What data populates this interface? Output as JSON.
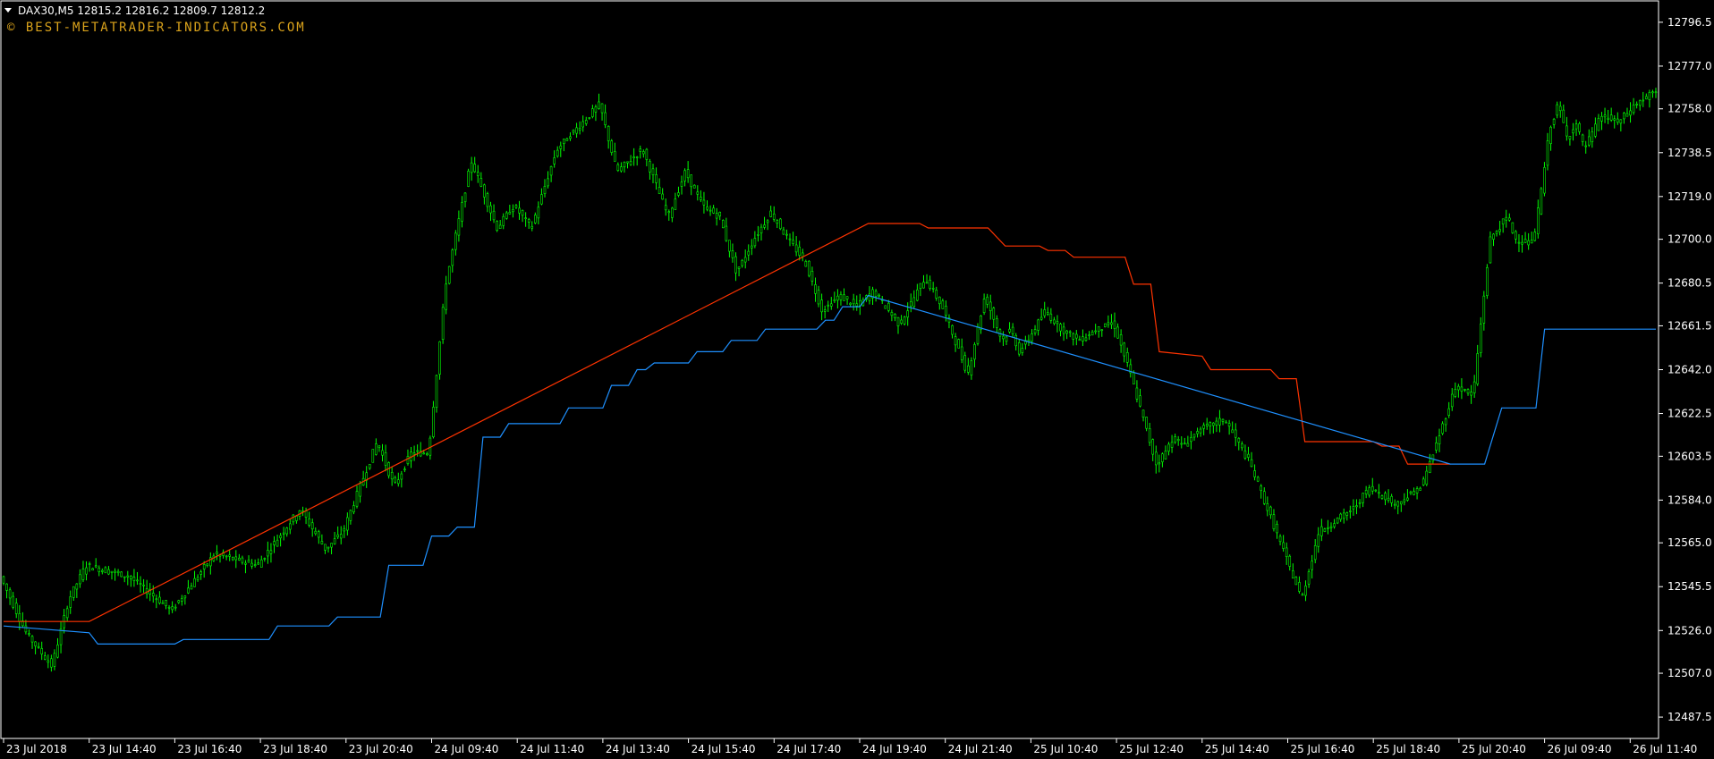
{
  "header": {
    "symbol_info": "DAX30,M5  12815.2 12816.2 12809.7 12812.2",
    "watermark": "© BEST-METATRADER-INDICATORS.COM"
  },
  "colors": {
    "background": "#000000",
    "frame": "#ffffff",
    "candle": "#00ff00",
    "stop_upper": "#ff3300",
    "stop_lower": "#1e90ff",
    "text": "#ffffff",
    "watermark": "#d9a21b"
  },
  "chart_data": {
    "type": "line",
    "title": "",
    "xlabel": "",
    "ylabel": "",
    "ylim": [
      12478,
      12806
    ],
    "y_ticks": [
      "12796.5",
      "12777.0",
      "12758.0",
      "12738.5",
      "12719.0",
      "12700.0",
      "12680.5",
      "12661.5",
      "12642.0",
      "12622.5",
      "12603.5",
      "12584.0",
      "12565.0",
      "12545.5",
      "12526.0",
      "12507.0",
      "12487.5"
    ],
    "x_ticks": [
      "23 Jul 2018",
      "23 Jul 14:40",
      "23 Jul 16:40",
      "23 Jul 18:40",
      "23 Jul 20:40",
      "24 Jul 09:40",
      "24 Jul 11:40",
      "24 Jul 13:40",
      "24 Jul 15:40",
      "24 Jul 17:40",
      "24 Jul 19:40",
      "24 Jul 21:40",
      "25 Jul 10:40",
      "25 Jul 12:40",
      "25 Jul 14:40",
      "25 Jul 16:40",
      "25 Jul 18:40",
      "25 Jul 20:40",
      "26 Jul 09:40",
      "26 Jul 11:40"
    ],
    "x_tick_positions": [
      0,
      10,
      20,
      30,
      40,
      50,
      60,
      70,
      80,
      90,
      100,
      110,
      120,
      130,
      140,
      150,
      160,
      170,
      180,
      190
    ],
    "x_range": [
      0,
      193
    ],
    "series": [
      {
        "name": "",
        "role": "price",
        "x": [
          0,
          3,
          6,
          8,
          10,
          15,
          20,
          25,
          30,
          35,
          38,
          40,
          44,
          46,
          48,
          50,
          52,
          55,
          58,
          60,
          62,
          65,
          70,
          72,
          75,
          78,
          80,
          82,
          84,
          86,
          88,
          90,
          92,
          94,
          96,
          98,
          100,
          102,
          105,
          108,
          110,
          113,
          115,
          117,
          118,
          119,
          120,
          122,
          124,
          126,
          128,
          130,
          132,
          135,
          136,
          137,
          138,
          140,
          143,
          146,
          150,
          152,
          154,
          156,
          158,
          160,
          163,
          166,
          168,
          170,
          172,
          174,
          176,
          177,
          179,
          180,
          181,
          182,
          183,
          184,
          185,
          187,
          189,
          191,
          193
        ],
        "y": [
          12550,
          12525,
          12510,
          12540,
          12555,
          12550,
          12535,
          12560,
          12555,
          12580,
          12562,
          12570,
          12610,
          12590,
          12605,
          12605,
          12680,
          12735,
          12705,
          12715,
          12705,
          12740,
          12760,
          12730,
          12740,
          12710,
          12730,
          12715,
          12710,
          12685,
          12700,
          12712,
          12700,
          12690,
          12668,
          12675,
          12670,
          12677,
          12662,
          12683,
          12670,
          12640,
          12675,
          12655,
          12660,
          12650,
          12655,
          12668,
          12660,
          12655,
          12660,
          12663,
          12640,
          12600,
          12605,
          12612,
          12608,
          12615,
          12620,
          12600,
          12560,
          12540,
          12570,
          12575,
          12580,
          12590,
          12582,
          12590,
          12612,
          12635,
          12630,
          12700,
          12710,
          12700,
          12698,
          12722,
          12750,
          12760,
          12745,
          12752,
          12740,
          12755,
          12752,
          12760,
          12765
        ]
      },
      {
        "name": "",
        "role": "stop-upper",
        "x": [
          0,
          10,
          101,
          107,
          108,
          115,
          117,
          121,
          122,
          124,
          125,
          131,
          132,
          134,
          135,
          140,
          141,
          148,
          149,
          151,
          152,
          160,
          161,
          163,
          164,
          169
        ],
        "y": [
          12530,
          12530,
          12707,
          12707,
          12705,
          12705,
          12697,
          12697,
          12695,
          12695,
          12692,
          12692,
          12680,
          12680,
          12650,
          12648,
          12642,
          12642,
          12638,
          12638,
          12610,
          12610,
          12608,
          12608,
          12600,
          12600
        ]
      },
      {
        "name": "",
        "role": "stop-lower",
        "x": [
          0,
          10,
          11,
          20,
          21,
          31,
          32,
          38,
          39,
          44,
          45,
          49,
          50,
          52,
          53,
          55,
          56,
          58,
          59,
          65,
          66,
          70,
          71,
          73,
          74,
          75,
          76,
          80,
          81,
          84,
          85,
          88,
          89,
          95,
          96,
          97,
          98,
          100,
          101,
          169,
          170,
          172,
          173,
          175,
          176,
          179,
          180,
          190,
          193
        ],
        "y": [
          12528,
          12525,
          12520,
          12520,
          12522,
          12522,
          12528,
          12528,
          12532,
          12532,
          12555,
          12555,
          12568,
          12568,
          12572,
          12572,
          12612,
          12612,
          12618,
          12618,
          12625,
          12625,
          12635,
          12635,
          12642,
          12642,
          12645,
          12645,
          12650,
          12650,
          12655,
          12655,
          12660,
          12660,
          12664,
          12664,
          12670,
          12670,
          12675,
          12600,
          12600,
          12600,
          12600,
          12625,
          12625,
          12625,
          12660,
          12660,
          12660
        ]
      }
    ]
  }
}
